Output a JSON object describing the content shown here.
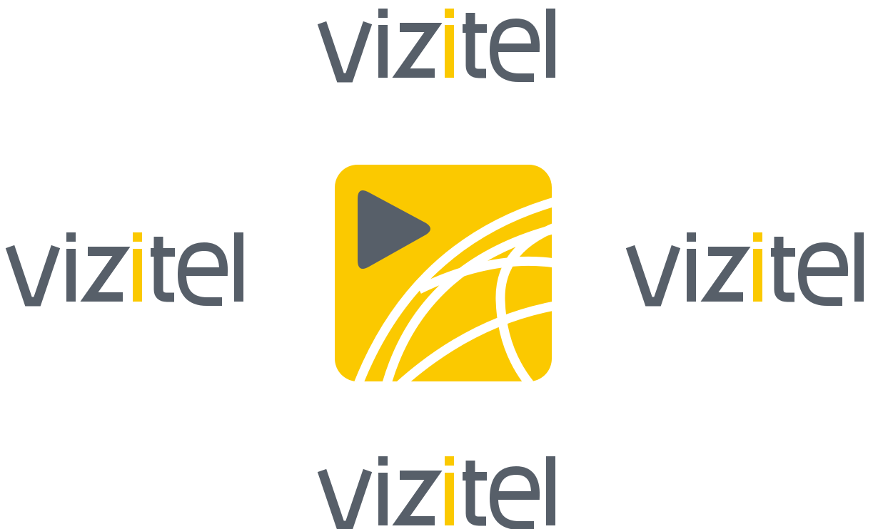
{
  "brand": {
    "name": "vizitel",
    "letters": [
      "v",
      "i",
      "z",
      "i",
      "t",
      "e",
      "l"
    ],
    "highlight_letter_index": 3
  },
  "colors": {
    "text_gray": "#575f69",
    "accent_yellow": "#fbc900",
    "background": "#ffffff",
    "icon_lines": "#ffffff"
  },
  "wordmarks": [
    {
      "position": "top"
    },
    {
      "position": "left"
    },
    {
      "position": "right"
    },
    {
      "position": "bottom"
    }
  ],
  "app_icon": {
    "icon": "play-icon",
    "shape": "rounded-square"
  }
}
